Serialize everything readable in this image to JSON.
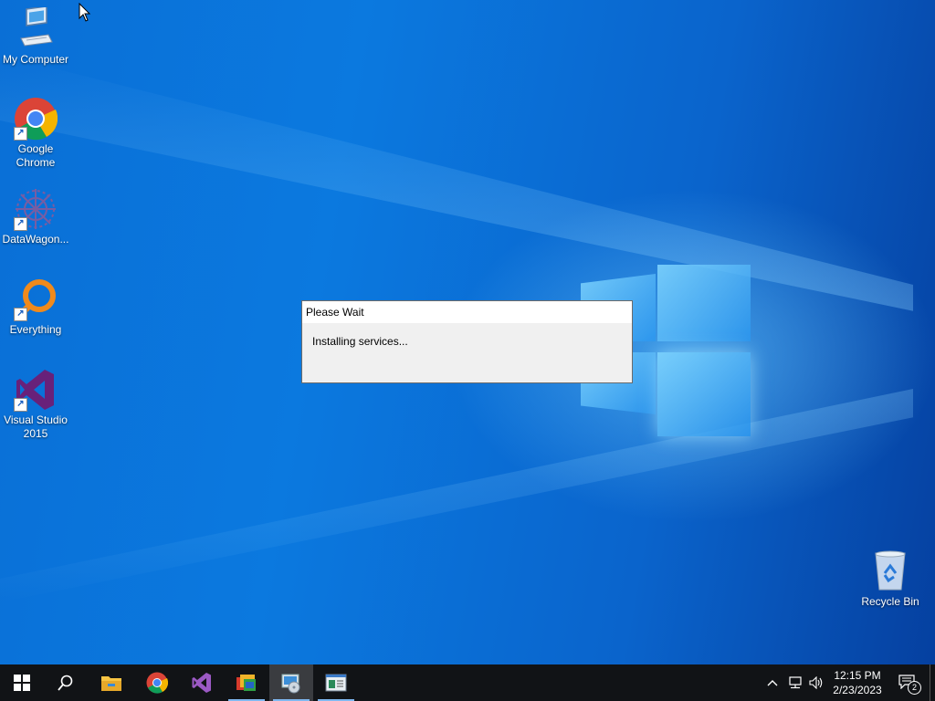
{
  "desktop": {
    "icons": [
      {
        "label": "My Computer",
        "icon": "computer-icon"
      },
      {
        "label": "Google Chrome",
        "icon": "chrome-icon"
      },
      {
        "label": "DataWagon...",
        "icon": "datawagon-icon"
      },
      {
        "label": "Everything",
        "icon": "everything-icon"
      },
      {
        "label": "Visual Studio 2015",
        "icon": "visual-studio-icon"
      },
      {
        "label": "Recycle Bin",
        "icon": "recycle-bin-icon"
      }
    ]
  },
  "dialog": {
    "title": "Please Wait",
    "message": "Installing services..."
  },
  "taskbar": {
    "buttons": [
      "start-icon",
      "search-icon",
      "file-explorer-icon",
      "chrome-icon",
      "visual-studio-icon",
      "app-icon",
      "installer-icon",
      "window-app-icon"
    ],
    "tray": {
      "icons": [
        "chevron-up-icon",
        "network-icon",
        "volume-icon"
      ],
      "time": "12:15 PM",
      "date": "2/23/2023",
      "notification_count": "2"
    }
  },
  "colors": {
    "desktop_blue": "#0a6fd6",
    "taskbar": "#111316",
    "dialog_bg": "#f0f0f0"
  }
}
